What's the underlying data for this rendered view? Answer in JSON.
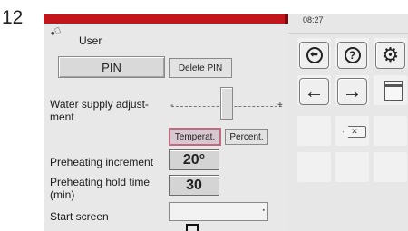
{
  "figure_number": "12",
  "header": {
    "time": "08:27"
  },
  "user_panel": {
    "title": "User",
    "pin_button": "PIN",
    "delete_pin_button": "Delete PIN",
    "water_supply_label": "Water supply adjust-\nment",
    "slider_minus": "-",
    "slider_plus": "+",
    "slider_value_fraction": 0.5,
    "mode_temperature": "Temperat.",
    "mode_percent": "Percent.",
    "preheat_increment_label": "Preheating increment",
    "preheat_increment_value": "20°",
    "preheat_hold_label": "Preheating hold time\n(min)",
    "preheat_hold_value": "30",
    "start_screen_label": "Start screen",
    "start_screen_value": ""
  },
  "colors": {
    "header_bar": "#c3161c",
    "selected_mode_border": "#c26a80"
  },
  "icons": [
    "back-circle-icon",
    "help-icon",
    "settings-gear-icon",
    "arrow-left-icon",
    "arrow-right-icon",
    "document-icon",
    "backspace-icon"
  ],
  "icon_glyphs": {
    "back": "⬅",
    "help": "?",
    "gear": "⚙",
    "left": "🡐",
    "right": "🡒",
    "backspace": "✕"
  }
}
